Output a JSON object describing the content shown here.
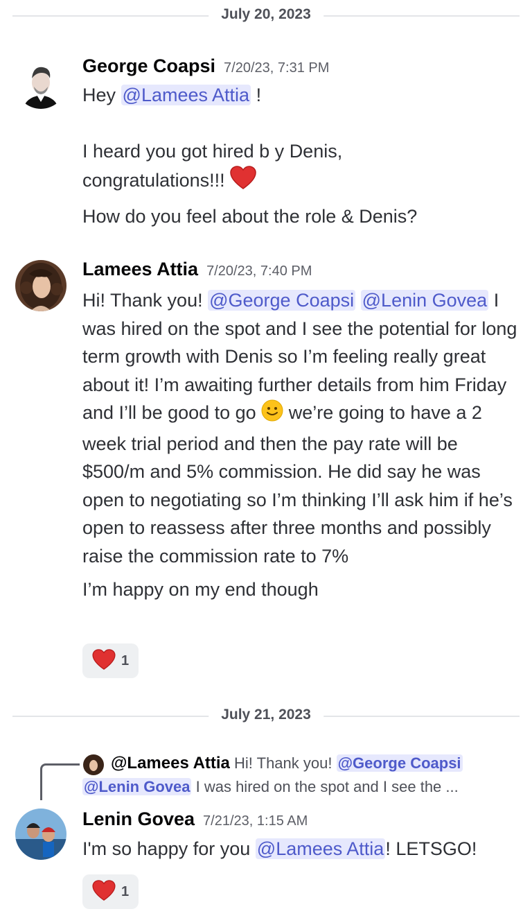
{
  "dividers": [
    {
      "date": "July 20, 2023"
    },
    {
      "date": "July 21, 2023"
    }
  ],
  "messages": [
    {
      "author": "George Coapsi",
      "timestamp": "7/20/23, 7:31 PM",
      "line1_prefix": "Hey",
      "line1_mention": "@Lamees Attia",
      "line1_suffix": "!",
      "line2": "I heard you got hired b y Denis,",
      "line3": "congratulations!!!",
      "line4": "How do you feel about the role & Denis?"
    },
    {
      "author": "Lamees Attia",
      "timestamp": "7/20/23, 7:40 PM",
      "prefix": "Hi! Thank you!",
      "mention1": "@George Coapsi",
      "mention2": "@Lenin Govea",
      "body_before_emoji": "I was hired on the spot and I see the potential for long term growth with Denis so I’m feeling really great about it! I’m awaiting further details from him Friday and I’ll be good to go",
      "body_after_emoji": "we’re going to have a 2 week trial period and then the pay rate will be $500/m and 5% commission. He did say he was open to negotiating so I’m thinking I’ll ask him if he’s open to reassess after three months and possibly raise the commission rate to 7%",
      "closing": "I’m happy on my end though",
      "reaction_count": "1"
    },
    {
      "reply_author": "@Lamees Attia",
      "reply_text_1": "Hi! Thank you!",
      "reply_mention_1": "@George Coapsi",
      "reply_mention_2": "@Lenin Govea",
      "reply_text_2": "I was hired on the spot and I see the ...",
      "author": "Lenin Govea",
      "timestamp": "7/21/23, 1:15 AM",
      "prefix": "I'm so happy for you",
      "mention": "@Lamees Attia",
      "suffix": "! LETSGO!",
      "reaction_count": "1"
    }
  ],
  "colors": {
    "mention_bg": "#e6e8fd",
    "mention_text": "#4e5aca",
    "reaction_bg": "#eef0f2"
  }
}
